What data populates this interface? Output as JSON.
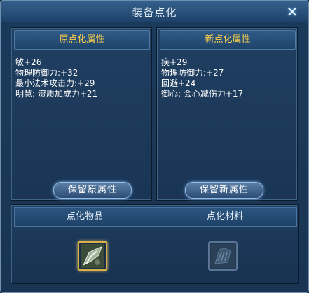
{
  "window": {
    "title": "装备点化"
  },
  "left_panel": {
    "header": "原点化属性",
    "attributes": [
      "敏+26",
      "物理防御力:+32",
      "最小法术攻击力:+29",
      "明慧: 资质加成力+21"
    ],
    "button_label": "保留原属性"
  },
  "right_panel": {
    "header": "新点化属性",
    "attributes": [
      "疾+29",
      "物理防御力:+27",
      "回避+24",
      "御心: 会心减伤力+17"
    ],
    "button_label": "保留新属性"
  },
  "bottom": {
    "item_label": "点化物品",
    "material_label": "点化材料"
  },
  "icons": {
    "close": "close-icon",
    "item": "equipment-item-icon",
    "material": "material-placeholder-icon"
  },
  "colors": {
    "header_text": "#ffd24a",
    "slot_border_active": "#d9b24a"
  }
}
